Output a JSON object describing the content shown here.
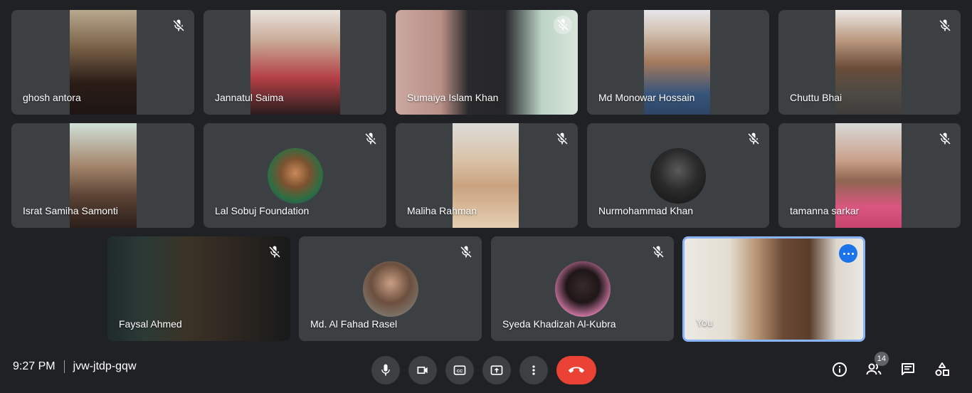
{
  "participants": [
    {
      "name": "ghosh antora",
      "muted": true
    },
    {
      "name": "Jannatul Saima",
      "muted": false
    },
    {
      "name": "Sumaiya Islam Khan",
      "muted": true
    },
    {
      "name": "Md Monowar Hossain",
      "muted": false
    },
    {
      "name": "Chuttu Bhai",
      "muted": true
    },
    {
      "name": "Israt Samiha Samonti",
      "muted": false
    },
    {
      "name": "Lal Sobuj Foundation",
      "muted": true
    },
    {
      "name": "Maliha Rahman",
      "muted": true
    },
    {
      "name": "Nurmohammad Khan",
      "muted": true
    },
    {
      "name": "tamanna sarkar",
      "muted": true
    },
    {
      "name": "Faysal Ahmed",
      "muted": true
    },
    {
      "name": "Md. Al Fahad Rasel",
      "muted": true
    },
    {
      "name": "Syeda Khadizah Al-Kubra",
      "muted": true
    }
  ],
  "self": {
    "label": "You"
  },
  "footer": {
    "time": "9:27 PM",
    "meeting_code": "jvw-jtdp-gqw",
    "participant_count": "14"
  },
  "controls": {
    "mic": "microphone-icon",
    "camera": "camera-icon",
    "captions": "captions-icon",
    "present": "present-icon",
    "more": "more-options-icon",
    "end": "end-call-icon"
  },
  "colors": {
    "background": "#202124",
    "tile": "#3c4043",
    "end_call": "#ea4335",
    "self_border": "#8ab4f8",
    "more_button": "#1a73e8"
  }
}
